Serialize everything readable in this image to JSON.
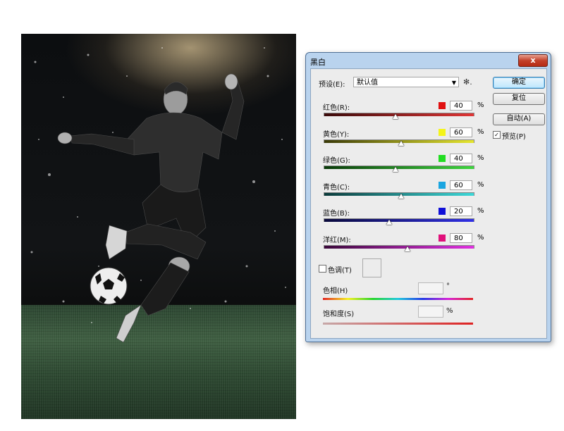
{
  "dialog": {
    "title": "黑白",
    "close_glyph": "x",
    "preset_label": "预设(E):",
    "preset_value": "默认值",
    "ok_label": "确定",
    "reset_label": "复位",
    "auto_label": "自动(A)",
    "preview_label": "预览(P)",
    "preview_checked": true,
    "percent_unit": "%",
    "sliders": [
      {
        "label": "红色(R):",
        "value": "40",
        "swatch": "#e01010",
        "track": [
          "#3a0a0a",
          "#e03535"
        ]
      },
      {
        "label": "黄色(Y):",
        "value": "60",
        "swatch": "#f4f41a",
        "track": [
          "#3a3a08",
          "#e6e62c"
        ]
      },
      {
        "label": "绿色(G):",
        "value": "40",
        "swatch": "#22dd22",
        "track": [
          "#0a3a0a",
          "#3ed63e"
        ]
      },
      {
        "label": "青色(C):",
        "value": "60",
        "swatch": "#1aa5e0",
        "track": [
          "#0a3a3a",
          "#3bd8d8"
        ]
      },
      {
        "label": "蓝色(B):",
        "value": "20",
        "swatch": "#1010d8",
        "track": [
          "#08083a",
          "#3030e6"
        ]
      },
      {
        "label": "洋红(M):",
        "value": "80",
        "swatch": "#e0107a",
        "track": [
          "#3a083a",
          "#e030e0"
        ]
      }
    ],
    "tint_label": "色调(T)",
    "tint_checked": false,
    "hue_label": "色相(H)",
    "hue_unit": "°",
    "saturation_label": "饱和度(S)",
    "saturation_unit": "%"
  },
  "canvas": {
    "icons": [
      "soccer-player-photo",
      "soccer-ball",
      "grass-field",
      "stadium-lights"
    ]
  }
}
